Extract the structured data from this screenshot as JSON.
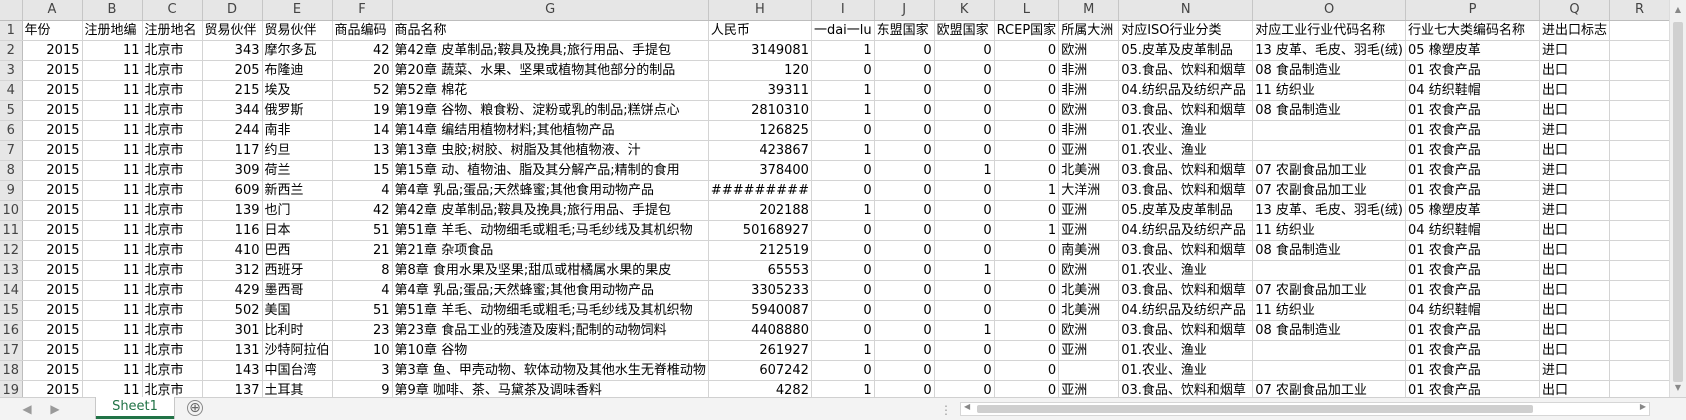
{
  "columns": [
    "A",
    "B",
    "C",
    "D",
    "E",
    "F",
    "G",
    "H",
    "I",
    "J",
    "K",
    "L",
    "M",
    "N",
    "O",
    "P",
    "Q",
    "R"
  ],
  "rows": [
    {
      "n": "1",
      "cells": [
        "年份",
        "注册地编",
        "注册地名",
        "贸易伙伴",
        "贸易伙伴",
        "商品编码",
        "商品名称",
        "人民币",
        "一dai一lu",
        "东盟国家",
        "欧盟国家",
        "RCEP国家",
        "所属大洲",
        "对应ISO行业分类",
        "对应工业行业代码名称",
        "行业七大类编码名称",
        "进出口标志",
        ""
      ]
    },
    {
      "n": "2",
      "cells": [
        "2015",
        "11",
        "北京市",
        "343",
        "摩尔多瓦",
        "42",
        "第42章 皮革制品;鞍具及挽具;旅行用品、手提包",
        "3149081",
        "1",
        "0",
        "0",
        "0",
        "欧洲",
        "05.皮革及皮革制品",
        "13 皮革、毛皮、羽毛(绒)",
        "05 橡塑皮革",
        "进口",
        ""
      ]
    },
    {
      "n": "3",
      "cells": [
        "2015",
        "11",
        "北京市",
        "205",
        "布隆迪",
        "20",
        "第20章 蔬菜、水果、坚果或植物其他部分的制品",
        "120",
        "0",
        "0",
        "0",
        "0",
        "非洲",
        "03.食品、饮料和烟草",
        "08 食品制造业",
        "01 农食产品",
        "出口",
        ""
      ]
    },
    {
      "n": "4",
      "cells": [
        "2015",
        "11",
        "北京市",
        "215",
        "埃及",
        "52",
        "第52章 棉花",
        "39311",
        "1",
        "0",
        "0",
        "0",
        "非洲",
        "04.纺织品及纺织产品",
        "11 纺织业",
        "04 纺织鞋帽",
        "出口",
        ""
      ]
    },
    {
      "n": "5",
      "cells": [
        "2015",
        "11",
        "北京市",
        "344",
        "俄罗斯",
        "19",
        "第19章 谷物、粮食粉、淀粉或乳的制品;糕饼点心",
        "2810310",
        "1",
        "0",
        "0",
        "0",
        "欧洲",
        "03.食品、饮料和烟草",
        "08 食品制造业",
        "01 农食产品",
        "出口",
        ""
      ]
    },
    {
      "n": "6",
      "cells": [
        "2015",
        "11",
        "北京市",
        "244",
        "南非",
        "14",
        "第14章 编结用植物材料;其他植物产品",
        "126825",
        "0",
        "0",
        "0",
        "0",
        "非洲",
        "01.农业、渔业",
        "",
        "01 农食产品",
        "进口",
        ""
      ]
    },
    {
      "n": "7",
      "cells": [
        "2015",
        "11",
        "北京市",
        "117",
        "约旦",
        "13",
        "第13章 虫胶;树胶、树脂及其他植物液、汁",
        "423867",
        "1",
        "0",
        "0",
        "0",
        "亚洲",
        "01.农业、渔业",
        "",
        "01 农食产品",
        "出口",
        ""
      ]
    },
    {
      "n": "8",
      "cells": [
        "2015",
        "11",
        "北京市",
        "309",
        "荷兰",
        "15",
        "第15章 动、植物油、脂及其分解产品;精制的食用",
        "378400",
        "0",
        "0",
        "1",
        "0",
        "北美洲",
        "03.食品、饮料和烟草",
        "07 农副食品加工业",
        "01 农食产品",
        "进口",
        ""
      ]
    },
    {
      "n": "9",
      "cells": [
        "2015",
        "11",
        "北京市",
        "609",
        "新西兰",
        "4",
        "第4章 乳品;蛋品;天然蜂蜜;其他食用动物产品",
        "#########",
        "0",
        "0",
        "0",
        "1",
        "大洋洲",
        "03.食品、饮料和烟草",
        "07 农副食品加工业",
        "01 农食产品",
        "进口",
        ""
      ]
    },
    {
      "n": "10",
      "cells": [
        "2015",
        "11",
        "北京市",
        "139",
        "也门",
        "42",
        "第42章 皮革制品;鞍具及挽具;旅行用品、手提包",
        "202188",
        "1",
        "0",
        "0",
        "0",
        "亚洲",
        "05.皮革及皮革制品",
        "13 皮革、毛皮、羽毛(绒)",
        "05 橡塑皮革",
        "进口",
        ""
      ]
    },
    {
      "n": "11",
      "cells": [
        "2015",
        "11",
        "北京市",
        "116",
        "日本",
        "51",
        "第51章 羊毛、动物细毛或粗毛;马毛纱线及其机织物",
        "50168927",
        "0",
        "0",
        "0",
        "1",
        "亚洲",
        "04.纺织品及纺织产品",
        "11 纺织业",
        "04 纺织鞋帽",
        "出口",
        ""
      ]
    },
    {
      "n": "12",
      "cells": [
        "2015",
        "11",
        "北京市",
        "410",
        "巴西",
        "21",
        "第21章 杂项食品",
        "212519",
        "0",
        "0",
        "0",
        "0",
        "南美洲",
        "03.食品、饮料和烟草",
        "08 食品制造业",
        "01 农食产品",
        "出口",
        ""
      ]
    },
    {
      "n": "13",
      "cells": [
        "2015",
        "11",
        "北京市",
        "312",
        "西班牙",
        "8",
        "第8章 食用水果及坚果;甜瓜或柑橘属水果的果皮",
        "65553",
        "0",
        "0",
        "1",
        "0",
        "欧洲",
        "01.农业、渔业",
        "",
        "01 农食产品",
        "出口",
        ""
      ]
    },
    {
      "n": "14",
      "cells": [
        "2015",
        "11",
        "北京市",
        "429",
        "墨西哥",
        "4",
        "第4章 乳品;蛋品;天然蜂蜜;其他食用动物产品",
        "3305233",
        "0",
        "0",
        "0",
        "0",
        "北美洲",
        "03.食品、饮料和烟草",
        "07 农副食品加工业",
        "01 农食产品",
        "出口",
        ""
      ]
    },
    {
      "n": "15",
      "cells": [
        "2015",
        "11",
        "北京市",
        "502",
        "美国",
        "51",
        "第51章 羊毛、动物细毛或粗毛;马毛纱线及其机织物",
        "5940087",
        "0",
        "0",
        "0",
        "0",
        "北美洲",
        "04.纺织品及纺织产品",
        "11 纺织业",
        "04 纺织鞋帽",
        "出口",
        ""
      ]
    },
    {
      "n": "16",
      "cells": [
        "2015",
        "11",
        "北京市",
        "301",
        "比利时",
        "23",
        "第23章 食品工业的残渣及废料;配制的动物饲料",
        "4408880",
        "0",
        "0",
        "1",
        "0",
        "欧洲",
        "03.食品、饮料和烟草",
        "08 食品制造业",
        "01 农食产品",
        "出口",
        ""
      ]
    },
    {
      "n": "17",
      "cells": [
        "2015",
        "11",
        "北京市",
        "131",
        "沙特阿拉伯",
        "10",
        "第10章 谷物",
        "261927",
        "1",
        "0",
        "0",
        "0",
        "亚洲",
        "01.农业、渔业",
        "",
        "01 农食产品",
        "出口",
        ""
      ]
    },
    {
      "n": "18",
      "cells": [
        "2015",
        "11",
        "北京市",
        "143",
        "中国台湾",
        "3",
        "第3章 鱼、甲壳动物、软体动物及其他水生无脊椎动物",
        "607242",
        "0",
        "0",
        "0",
        "0",
        "",
        "01.农业、渔业",
        "",
        "01 农食产品",
        "进口",
        ""
      ]
    },
    {
      "n": "19",
      "cells": [
        "2015",
        "11",
        "北京市",
        "137",
        "土耳其",
        "9",
        "第9章 咖啡、茶、马黛茶及调味香料",
        "4282",
        "1",
        "0",
        "0",
        "0",
        "亚洲",
        "03.食品、饮料和烟草",
        "07 农副食品加工业",
        "01 农食产品",
        "出口",
        ""
      ]
    }
  ],
  "numeric_columns": [
    0,
    1,
    3,
    5,
    7,
    8,
    9,
    10,
    11
  ],
  "sheet_tab": "Sheet1",
  "add_sheet_icon": "⊕"
}
